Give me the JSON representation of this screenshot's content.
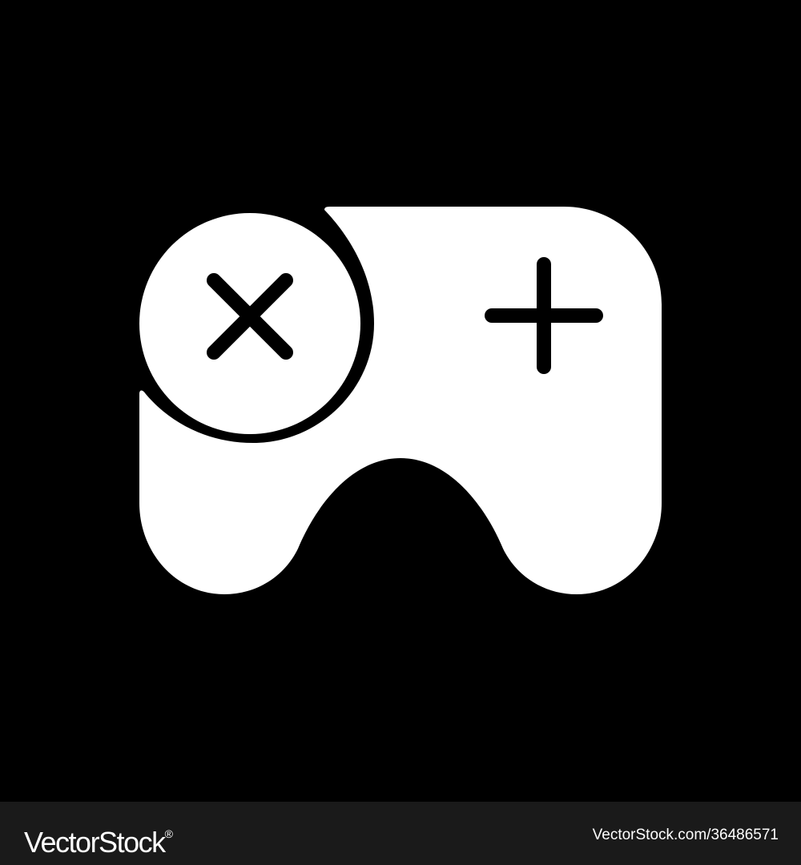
{
  "colors": {
    "background": "#000000",
    "icon": "#ffffff",
    "footer_background": "#1a1a1a",
    "footer_text": "#ffffff"
  },
  "icon": {
    "name": "gamepad-icon",
    "buttons": [
      "x-button-icon",
      "plus-button-icon"
    ]
  },
  "watermark": {
    "brand": "VectorStock",
    "registered_mark": "®",
    "image_id": "VectorStock.com/36486571"
  }
}
